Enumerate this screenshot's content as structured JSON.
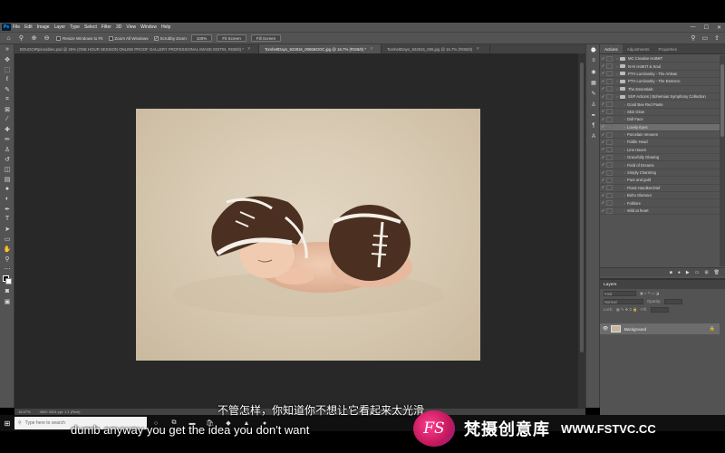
{
  "menubar": {
    "logo": "Ps",
    "items": [
      "File",
      "Edit",
      "Image",
      "Layer",
      "Type",
      "Select",
      "Filter",
      "3D",
      "View",
      "Window",
      "Help"
    ],
    "window_controls": [
      "—",
      "☐",
      "✕"
    ]
  },
  "options": {
    "resize_windows": "Resize Windows to Fit",
    "zoom_all": "Zoom All Windows",
    "scrubby_zoom": "Scrubby Zoom",
    "zoom_pct": "100%",
    "fit_screen": "Fit Screen",
    "fill_screen": "Fill Screen"
  },
  "tabs": [
    {
      "label": "BOUDOIRpinnables.psd @ 25% (ONE HOUR SESSION ONLINE PROOF GALLERY PROFESSIONAL IMAGE EDITIN, RGB/8) *",
      "active": false
    },
    {
      "label": "TomhettDays_922816_0065BOOC.jpg @ 16.7% (RGB/8) *",
      "active": true
    },
    {
      "label": "TomhettDays_922816_006.jpg @ 16.7% (RGB/8)",
      "active": false
    }
  ],
  "status": {
    "zoom": "16.67%",
    "doc_size": "4500 3024 ppi: 1:1 (Rich)"
  },
  "panels": {
    "tabs": [
      "Actions",
      "Adjustments",
      "Properties"
    ],
    "actions": [
      {
        "name": "MC Creative HotMIT",
        "type": "folder"
      },
      {
        "name": "N+K HotKIT & Soul",
        "type": "folder"
      },
      {
        "name": "PTH Luminosity - The Artisan",
        "type": "folder"
      },
      {
        "name": "PTH Luminosity - The Essence",
        "type": "folder"
      },
      {
        "name": "The Essentials",
        "type": "folder"
      },
      {
        "name": "SSP Actions | Bohemian Symphony Collection",
        "type": "folder"
      },
      {
        "name": "Good Bee Red Paste",
        "type": "action"
      },
      {
        "name": "Skin Glow",
        "type": "action"
      },
      {
        "name": "Doll Face",
        "type": "action"
      },
      {
        "name": "Lovely Eyes",
        "type": "action",
        "selected": true
      },
      {
        "name": "Porcelain Veneers",
        "type": "action"
      },
      {
        "name": "Fiddle Head",
        "type": "action"
      },
      {
        "name": "Line Haven",
        "type": "action"
      },
      {
        "name": "Gracefully Glowing",
        "type": "action"
      },
      {
        "name": "Field of Dreams",
        "type": "action"
      },
      {
        "name": "Simply Charming",
        "type": "action"
      },
      {
        "name": "Pure and gold",
        "type": "action"
      },
      {
        "name": "Floral Handkerchief",
        "type": "action"
      },
      {
        "name": "Boho Glamour",
        "type": "action"
      },
      {
        "name": "Folklore",
        "type": "action"
      },
      {
        "name": "Wild at heart",
        "type": "action"
      }
    ],
    "layers": {
      "title": "Layers",
      "kind_placeholder": "Kind",
      "mode": "Normal",
      "opacity_label": "Opacity:",
      "lock_label": "Lock:",
      "fill_label": "Fill:",
      "layer_name": "Background"
    }
  },
  "taskbar": {
    "search_placeholder": "Type here to search"
  },
  "subtitles": {
    "cn": "不管怎样，你知道你不想让它看起来太光滑",
    "en": "dumb anyway you get the idea you don't want"
  },
  "watermark": {
    "logo": "FS",
    "text": "梵摄创意库",
    "url": "WWW.FSTVC.CC"
  },
  "colors": {
    "ui_bg": "#535353",
    "canvas_bg": "#282828",
    "photo_bg": "#d9cbb4",
    "accent": "#c2185b"
  }
}
